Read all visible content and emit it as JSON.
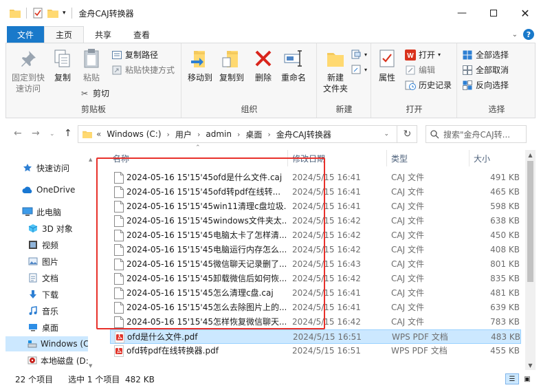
{
  "window": {
    "title": "金舟CAJ转换器"
  },
  "tabs": {
    "file": "文件",
    "home": "主页",
    "share": "共享",
    "view": "查看"
  },
  "ribbon": {
    "pin_quick": "固定到快\n速访问",
    "copy": "复制",
    "paste": "粘贴",
    "copy_path": "复制路径",
    "paste_shortcut": "粘贴快捷方式",
    "cut": "剪切",
    "clipboard_group": "剪贴板",
    "move_to": "移动到",
    "copy_to": "复制到",
    "delete": "删除",
    "rename": "重命名",
    "organize_group": "组织",
    "new_folder": "新建\n文件夹",
    "new_group": "新建",
    "properties": "属性",
    "open": "打开",
    "edit": "编辑",
    "history": "历史记录",
    "open_group": "打开",
    "select_all": "全部选择",
    "select_none": "全部取消",
    "invert_selection": "反向选择",
    "select_group": "选择"
  },
  "address": {
    "prefix": "«",
    "crumbs": [
      "Windows (C:)",
      "用户",
      "admin",
      "桌面",
      "金舟CAJ转换器"
    ],
    "search_placeholder": "搜索\"金舟CAJ转..."
  },
  "nav": {
    "items": [
      {
        "label": "快速访问",
        "icon": "star-icon"
      },
      {
        "label": "OneDrive",
        "icon": "cloud-icon"
      },
      {
        "label": "此电脑",
        "icon": "pc-icon"
      },
      {
        "label": "3D 对象",
        "icon": "cube-icon"
      },
      {
        "label": "视频",
        "icon": "video-icon"
      },
      {
        "label": "图片",
        "icon": "picture-icon"
      },
      {
        "label": "文档",
        "icon": "document-icon"
      },
      {
        "label": "下载",
        "icon": "download-icon"
      },
      {
        "label": "音乐",
        "icon": "music-icon"
      },
      {
        "label": "桌面",
        "icon": "desktop-icon"
      },
      {
        "label": "Windows (C:)",
        "icon": "drive-icon"
      },
      {
        "label": "本地磁盘 (D:)",
        "icon": "disk-icon"
      }
    ]
  },
  "columns": {
    "name": "名称",
    "date": "修改日期",
    "type": "类型",
    "size": "大小"
  },
  "files": [
    {
      "name": "2024-05-16 15'15'45ofd是什么文件.caj",
      "date": "2024/5/15 16:41",
      "type": "CAJ 文件",
      "size": "491 KB",
      "kind": "caj"
    },
    {
      "name": "2024-05-16 15'15'45ofd转pdf在线转...",
      "date": "2024/5/15 16:41",
      "type": "CAJ 文件",
      "size": "465 KB",
      "kind": "caj"
    },
    {
      "name": "2024-05-16 15'15'45win11清理c盘垃圾...",
      "date": "2024/5/15 16:41",
      "type": "CAJ 文件",
      "size": "598 KB",
      "kind": "caj"
    },
    {
      "name": "2024-05-16 15'15'45windows文件夹太...",
      "date": "2024/5/15 16:42",
      "type": "CAJ 文件",
      "size": "638 KB",
      "kind": "caj"
    },
    {
      "name": "2024-05-16 15'15'45电脑太卡了怎样清...",
      "date": "2024/5/15 16:42",
      "type": "CAJ 文件",
      "size": "450 KB",
      "kind": "caj"
    },
    {
      "name": "2024-05-16 15'15'45电脑运行内存怎么...",
      "date": "2024/5/15 16:42",
      "type": "CAJ 文件",
      "size": "408 KB",
      "kind": "caj"
    },
    {
      "name": "2024-05-16 15'15'45微信聊天记录删了...",
      "date": "2024/5/15 16:43",
      "type": "CAJ 文件",
      "size": "801 KB",
      "kind": "caj"
    },
    {
      "name": "2024-05-16 15'15'45卸载微信后如何恢...",
      "date": "2024/5/15 16:42",
      "type": "CAJ 文件",
      "size": "835 KB",
      "kind": "caj"
    },
    {
      "name": "2024-05-16 15'15'45怎么清理c盘.caj",
      "date": "2024/5/15 16:41",
      "type": "CAJ 文件",
      "size": "481 KB",
      "kind": "caj"
    },
    {
      "name": "2024-05-16 15'15'45怎么去除图片上的...",
      "date": "2024/5/15 16:41",
      "type": "CAJ 文件",
      "size": "639 KB",
      "kind": "caj"
    },
    {
      "name": "2024-05-16 15'15'45怎样恢复微信聊天...",
      "date": "2024/5/15 16:42",
      "type": "CAJ 文件",
      "size": "783 KB",
      "kind": "caj"
    },
    {
      "name": "ofd是什么文件.pdf",
      "date": "2024/5/15 16:51",
      "type": "WPS PDF 文档",
      "size": "483 KB",
      "kind": "pdf",
      "selected": true
    },
    {
      "name": "ofd转pdf在线转换器.pdf",
      "date": "2024/5/15 16:51",
      "type": "WPS PDF 文档",
      "size": "455 KB",
      "kind": "pdf"
    }
  ],
  "status": {
    "count": "22 个项目",
    "selection": "选中 1 个项目  482 KB"
  }
}
